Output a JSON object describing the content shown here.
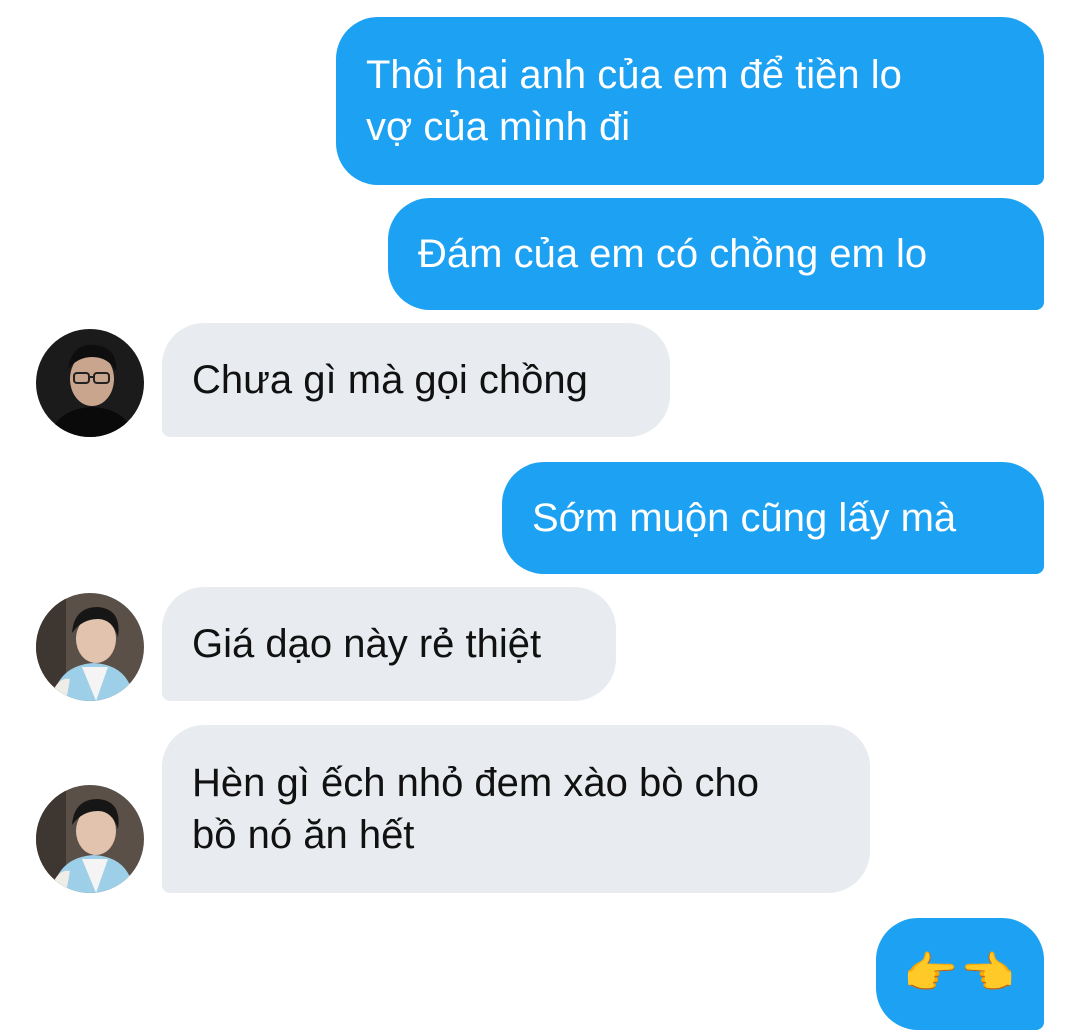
{
  "conversation": {
    "messages": [
      {
        "side": "sent",
        "text": "Thôi hai anh của em để tiền lo\nvợ của mình đi"
      },
      {
        "side": "sent",
        "text": "Đám của em có chồng em lo"
      },
      {
        "side": "received",
        "text": "Chưa gì mà gọi chồng",
        "avatar": "avatar-man-glasses"
      },
      {
        "side": "sent",
        "text": "Sớm muộn cũng lấy mà"
      },
      {
        "side": "received",
        "text": "Giá dạo này rẻ thiệt",
        "avatar": "avatar-man-hanbok"
      },
      {
        "side": "received",
        "text": "Hèn gì ếch nhỏ đem xào bò cho\nbồ nó ăn hết",
        "avatar": "avatar-man-hanbok"
      },
      {
        "side": "sent",
        "text": "👉👈"
      }
    ]
  },
  "colors": {
    "sent_bubble": "#1da1f2",
    "received_bubble": "#e8ecf0",
    "background": "#ffffff"
  }
}
